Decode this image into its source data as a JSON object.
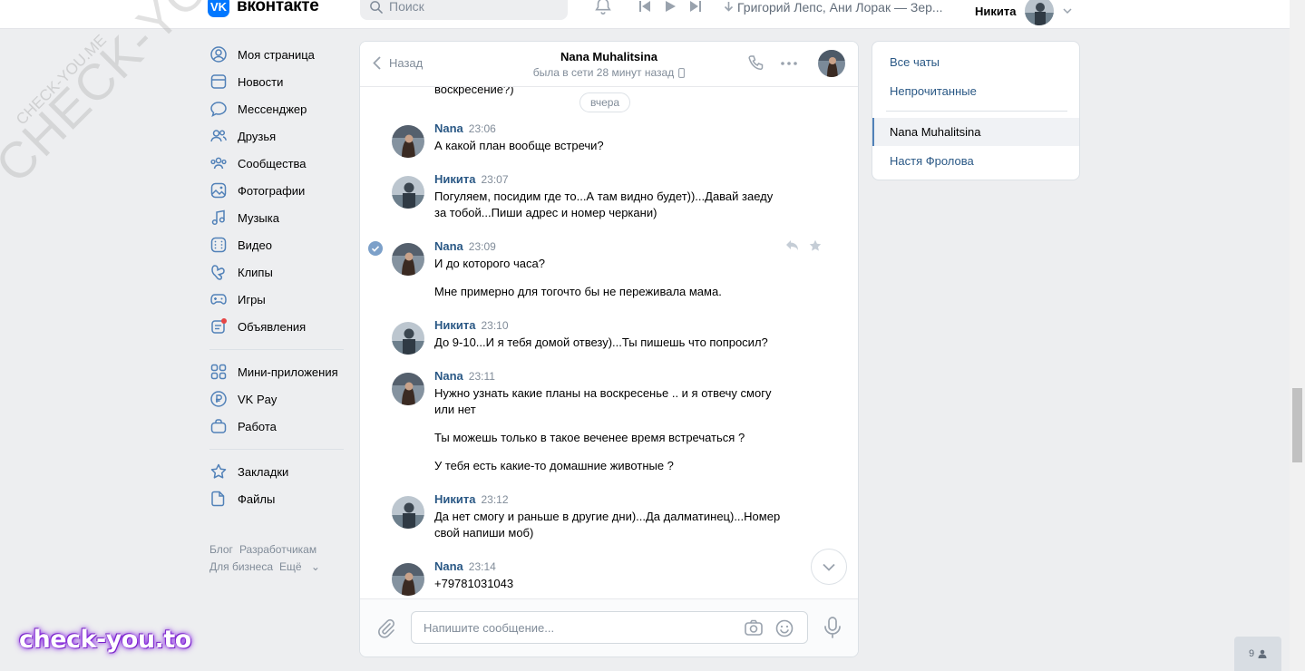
{
  "header": {
    "logo_text": "вконтакте",
    "logo_mark": "VK",
    "search_placeholder": "Поиск",
    "track": "Григорий Лепс, Ани Лорак — Зер...",
    "user_name": "Никита"
  },
  "nav": {
    "items": [
      {
        "label": "Моя страница",
        "icon": "user-circle-icon"
      },
      {
        "label": "Новости",
        "icon": "news-icon"
      },
      {
        "label": "Мессенджер",
        "icon": "message-icon"
      },
      {
        "label": "Друзья",
        "icon": "friends-icon"
      },
      {
        "label": "Сообщества",
        "icon": "communities-icon"
      },
      {
        "label": "Фотографии",
        "icon": "photo-icon"
      },
      {
        "label": "Музыка",
        "icon": "music-icon"
      },
      {
        "label": "Видео",
        "icon": "video-icon"
      },
      {
        "label": "Клипы",
        "icon": "clips-icon"
      },
      {
        "label": "Игры",
        "icon": "games-icon"
      },
      {
        "label": "Объявления",
        "icon": "ads-icon"
      }
    ],
    "items2": [
      {
        "label": "Мини-приложения",
        "icon": "apps-icon"
      },
      {
        "label": "VK Pay",
        "icon": "vkpay-icon"
      },
      {
        "label": "Работа",
        "icon": "work-icon"
      }
    ],
    "items3": [
      {
        "label": "Закладки",
        "icon": "bookmark-icon"
      },
      {
        "label": "Файлы",
        "icon": "file-icon"
      }
    ],
    "footer": [
      "Блог",
      "Разработчикам",
      "Для бизнеса",
      "Ещё"
    ]
  },
  "chat": {
    "back_label": "Назад",
    "peer_name": "Nana Muhalitsina",
    "peer_status": "была в сети 28 минут назад",
    "date_pill": "вчера",
    "top_partial": "воскресение?)",
    "messages": [
      {
        "author": "Nana",
        "time": "23:06",
        "lines": [
          "А какой план вообще встречи?"
        ]
      },
      {
        "author": "Никита",
        "time": "23:07",
        "lines": [
          "Погуляем, посидим где то...А там видно будет))...Давай заеду за тобой...Пиши адрес и номер черкани)"
        ]
      },
      {
        "author": "Nana",
        "time": "23:09",
        "lines": [
          "И до которого часа?",
          "Мне примерно для тогочто бы не переживала мама."
        ]
      },
      {
        "author": "Никита",
        "time": "23:10",
        "lines": [
          "До 9-10...И я тебя домой отвезу)...Ты пишешь что попросил?"
        ]
      },
      {
        "author": "Nana",
        "time": "23:11",
        "lines": [
          "Нужно узнать какие планы на воскресенье .. и я отвечу смогу или нет",
          "Ты можешь только в такое веченее время встречаться ?",
          "У тебя есть какие-то домашние животные ?"
        ]
      },
      {
        "author": "Никита",
        "time": "23:12",
        "lines": [
          "Да нет смогу и раньше в другие дни)...Да далматинец)...Номер свой напиши моб)"
        ]
      },
      {
        "author": "Nana",
        "time": "23:14",
        "lines": [
          "+79781031043"
        ]
      }
    ],
    "composer_placeholder": "Напишите сообщение..."
  },
  "right": {
    "items": [
      "Все чаты",
      "Непрочитанные",
      "Nana Muhalitsina",
      "Настя Фролова"
    ]
  },
  "online_count": "9",
  "watermarks": {
    "big": "CHECK-YOU.ME",
    "small": "CHECK-YOU.ME",
    "brand": "check-you.to"
  },
  "colors": {
    "accent": "#2a5885",
    "brand": "#0077ff",
    "background": "#edeef0",
    "muted": "#818c99"
  }
}
